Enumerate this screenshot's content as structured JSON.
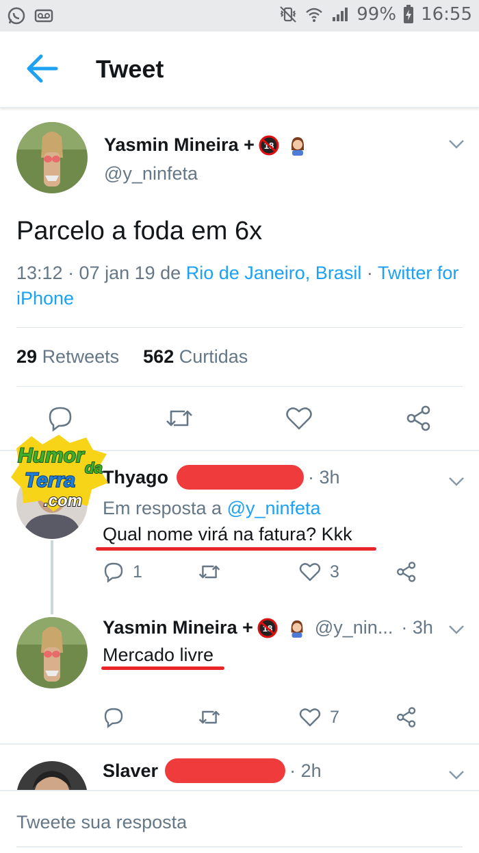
{
  "status_bar": {
    "battery": "99%",
    "time": "16:55"
  },
  "header": {
    "title": "Tweet"
  },
  "main_tweet": {
    "name": "Yasmin Mineira +",
    "handle": "@y_ninfeta",
    "text": "Parcelo a foda em 6x",
    "time_date": "13:12 · 07 jan 19 de ",
    "location": "Rio de Janeiro, Brasil",
    "separator": " · ",
    "source": "Twitter for iPhone",
    "retweets_count": "29",
    "retweets_label": "Retweets",
    "likes_count": "562",
    "likes_label": "Curtidas"
  },
  "replies": [
    {
      "name": "Thyago",
      "time": "· 3h",
      "reply_to_prefix": "Em resposta a ",
      "reply_to_handle": "@y_ninfeta",
      "text": "Qual nome virá na fatura? Kkk",
      "reply_count": "1",
      "like_count": "3"
    },
    {
      "name": "Yasmin Mineira +",
      "handle": "@y_nin...",
      "time": "· 3h",
      "text": "Mercado livre",
      "like_count": "7"
    },
    {
      "name": "Slaver",
      "time": "· 2h"
    }
  ],
  "compose": {
    "placeholder": "Tweete sua resposta"
  },
  "watermark": {
    "line1": "Humor",
    "line2": "da",
    "line3": "Terra",
    "line4": ".com"
  },
  "colors": {
    "accent": "#1da1f2",
    "redaction": "#ef3b3b",
    "underline": "#e8262a"
  }
}
